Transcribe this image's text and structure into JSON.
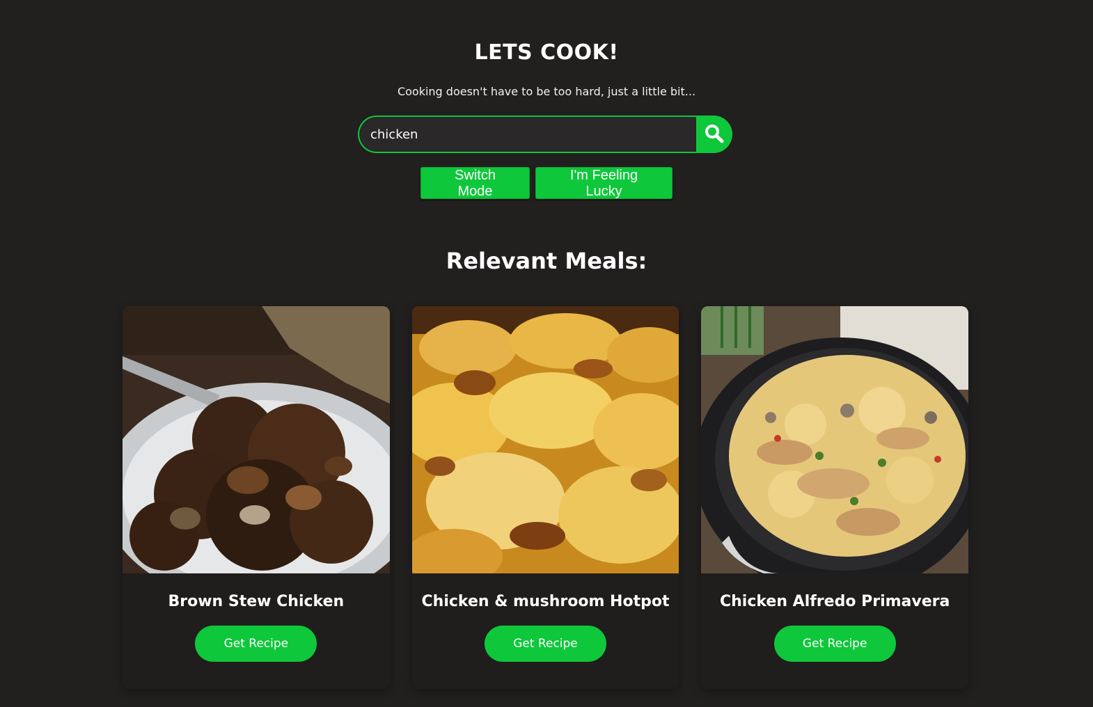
{
  "header": {
    "title": "LETS COOK!",
    "subtitle": "Cooking doesn't have to be too hard, just a little bit..."
  },
  "search": {
    "value": "chicken",
    "button_icon": "search-icon"
  },
  "actions": {
    "switch_mode_label": "Switch Mode",
    "feeling_lucky_label": "I'm Feeling Lucky"
  },
  "results": {
    "heading": "Relevant Meals:",
    "meals": [
      {
        "name": "Brown Stew Chicken",
        "button_label": "Get Recipe"
      },
      {
        "name": "Chicken & mushroom Hotpot",
        "button_label": "Get Recipe"
      },
      {
        "name": "Chicken Alfredo Primavera",
        "button_label": "Get Recipe"
      }
    ]
  },
  "colors": {
    "background": "#221f1f",
    "accent": "#0ec73a",
    "text": "#ffffff"
  }
}
